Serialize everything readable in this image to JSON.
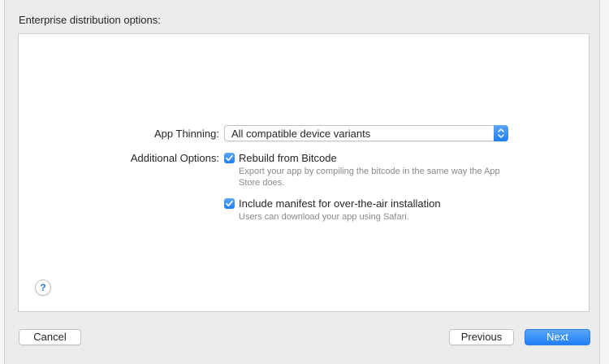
{
  "dialog": {
    "heading": "Enterprise distribution options:"
  },
  "app_thinning": {
    "label": "App Thinning:",
    "selected": "All compatible device variants"
  },
  "additional_options": {
    "label": "Additional Options:",
    "rebuild_bitcode": {
      "label": "Rebuild from Bitcode",
      "description": "Export your app by compiling the bitcode in the same way the App Store does.",
      "checked": true
    },
    "include_manifest": {
      "label": "Include manifest for over-the-air installation",
      "description": "Users can download your app using Safari.",
      "checked": true
    }
  },
  "help": {
    "glyph": "?"
  },
  "buttons": {
    "cancel": "Cancel",
    "previous": "Previous",
    "next": "Next"
  },
  "colors": {
    "accent": "#1f7ef4",
    "panel_bg": "#ffffff",
    "window_bg": "#ececec",
    "secondary_text": "#8a8a8a"
  },
  "icons": {
    "popup_arrows": "chevron-up-down-icon",
    "checkbox_check": "checkmark-icon",
    "help": "question-mark-icon"
  }
}
